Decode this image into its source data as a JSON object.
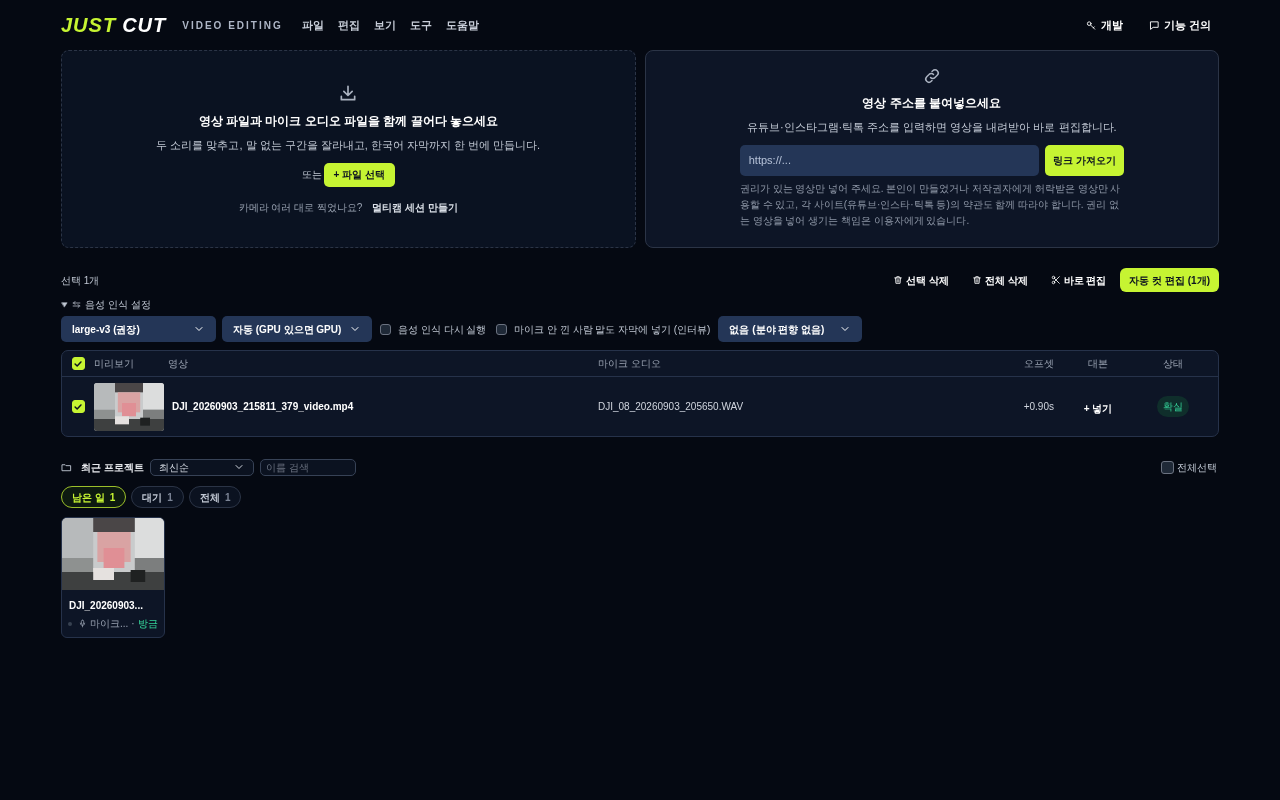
{
  "header": {
    "logo": [
      {
        "text": "JUST",
        "accent": true
      },
      {
        "text": "CUT",
        "accent": false
      }
    ],
    "subtitle": "VIDEO EDITING",
    "menu": [
      "파일",
      "편집",
      "보기",
      "도구",
      "도움말"
    ],
    "links": [
      {
        "label": "개발",
        "kind": "key"
      },
      {
        "label": "기능 건의",
        "kind": "chat"
      }
    ]
  },
  "drop_panel": {
    "title": "영상 파일과 마이크 오디오 파일을 함께 끌어다 놓으세요",
    "description": "두 소리를 맞추고, 말 없는 구간을 잘라내고, 한국어 자막까지 한 번에 만듭니다.",
    "or_label": "또는",
    "button": "+ 파일 선택",
    "question": "카메라 여러 대로 찍었나요?",
    "link": "멀티캠 세션 만들기"
  },
  "url_panel": {
    "title": "영상 주소를 붙여넣으세요",
    "description": "유튜브·인스타그램·틱톡 주소를 입력하면 영상을 내려받아 바로 편집합니다.",
    "placeholder": "https://...",
    "button": "링크 가져오기",
    "notice": "권리가 있는 영상만 넣어 주세요. 본인이 만들었거나 저작권자에게 허락받은 영상만 사용할 수 있고, 각 사이트(유튜브·인스타·틱톡 등)의 약관도 함께 따라야 합니다. 권리 없는 영상을 넣어 생기는 책임은 이용자에게 있습니다."
  },
  "selection": {
    "count": "선택 1개",
    "actions": [
      {
        "label": "선택 삭제",
        "kind": "trash"
      },
      {
        "label": "전체 삭제",
        "kind": "trash"
      },
      {
        "label": "바로 편집",
        "kind": "scissors"
      },
      {
        "label": "자동 컷 편집 (1개)",
        "kind": "primary"
      }
    ]
  },
  "asr_settings": {
    "label": "음성 인식 설정",
    "expanded": true,
    "controls": [
      {
        "kind": "select",
        "value": "large-v3 (권장)"
      },
      {
        "kind": "select",
        "value": "자동 (GPU 있으면 GPU)"
      },
      {
        "kind": "checkbox",
        "label": "음성 인식 다시 실행",
        "checked": false
      },
      {
        "kind": "checkbox",
        "label": "마이크 안 낀 사람 말도 자막에 넣기 (인터뷰)",
        "checked": false
      },
      {
        "kind": "select",
        "value": "없음 (분야 편향 없음)"
      }
    ]
  },
  "table": {
    "all_checked": true,
    "columns": [
      "미리보기",
      "영상",
      "마이크 오디오",
      "오프셋",
      "대본",
      "상태"
    ],
    "rows": [
      {
        "checked": true,
        "video": "DJI_20260903_215811_379_video.mp4",
        "mic": "DJI_08_20260903_205650.WAV",
        "offset": "+0.90s",
        "script": "+ 넣기",
        "status": "확실"
      }
    ]
  },
  "projects": {
    "title": "최근 프로젝트",
    "sort": "최신순",
    "search_placeholder": "이름 검색",
    "select_all": {
      "label": "전체선택",
      "checked": false
    },
    "filters": [
      {
        "label": "남은 일",
        "count": "1",
        "selected": true
      },
      {
        "label": "대기",
        "count": "1",
        "selected": false
      },
      {
        "label": "전체",
        "count": "1",
        "selected": false
      }
    ],
    "cards": [
      {
        "name": "DJI_20260903...",
        "mic": "마이크...",
        "separator": "·",
        "time": "방금"
      }
    ]
  }
}
